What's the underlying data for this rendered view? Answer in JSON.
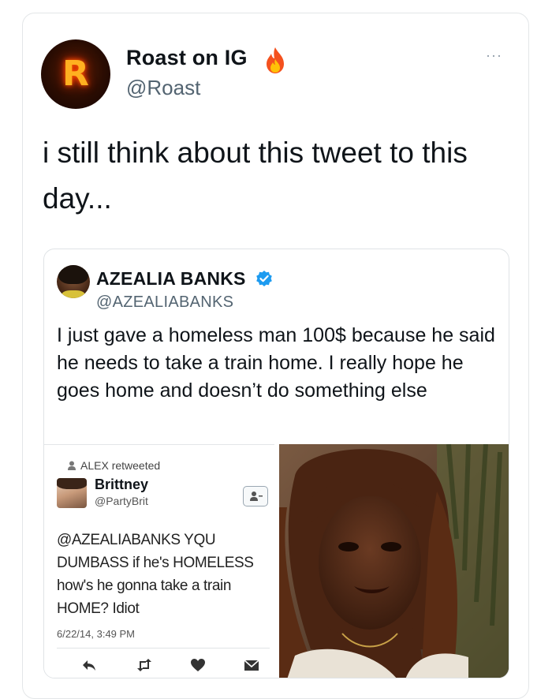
{
  "tweet": {
    "display_name": "Roast on IG",
    "handle": "@Roast",
    "more_label": "···",
    "text": "i still think about this tweet to this day...",
    "avatar_letter": "R"
  },
  "quoted": {
    "display_name": "AZEALIA BANKS",
    "handle": "@AZEALIABANKS",
    "text": "I just gave a homeless man 100$ because he said he needs to take a train home. I really hope he goes home and doesn’t do something else"
  },
  "embedded_tweet": {
    "retweet_line": "ALEX retweeted",
    "display_name": "Brittney",
    "handle": "@PartyBrit",
    "text": "@AZEALIABANKS YQU DUMBASS if he's HOMELESS how's he gonna take a train HOME? Idiot",
    "date": "6/22/14, 3:49 PM",
    "actions": [
      "reply-icon",
      "retweet-icon",
      "like-icon",
      "message-icon"
    ]
  },
  "colors": {
    "text": "#0f1419",
    "secondary": "#536471",
    "verified": "#1d9bf0",
    "border": "#e3e6e8"
  }
}
